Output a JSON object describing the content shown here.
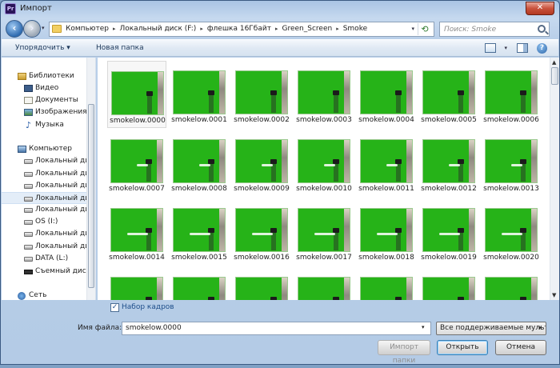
{
  "window": {
    "title": "Импорт",
    "app_icon": "Pr",
    "close": "✕"
  },
  "address": {
    "crumbs": [
      "Компьютер",
      "Локальный диск (F:)",
      "флешка 16Гбайт",
      "Green_Screen",
      "Smoke"
    ],
    "search_placeholder": "Поиск: Smoke"
  },
  "toolbar": {
    "organize_label": "Упорядочить ▾",
    "new_folder_label": "Новая папка",
    "help": "?"
  },
  "sidebar": {
    "items": [
      {
        "label": "Библиотеки",
        "icon": "library-icon"
      },
      {
        "label": "Видео",
        "icon": "video-icon"
      },
      {
        "label": "Документы",
        "icon": "documents-icon"
      },
      {
        "label": "Изображения",
        "icon": "pictures-icon"
      },
      {
        "label": "Музыка",
        "icon": "music-icon"
      },
      {
        "label": "Компьютер",
        "icon": "computer-icon"
      },
      {
        "label": "Локальный диск (C:)",
        "icon": "drive-icon"
      },
      {
        "label": "Локальный диск (D:)",
        "icon": "drive-icon"
      },
      {
        "label": "Локальный диск (E:)",
        "icon": "drive-icon"
      },
      {
        "label": "Локальный диск (F:)",
        "icon": "drive-icon"
      },
      {
        "label": "Локальный диск (G:)",
        "icon": "drive-icon"
      },
      {
        "label": "OS (I:)",
        "icon": "drive-icon"
      },
      {
        "label": "Локальный диск (J:)",
        "icon": "drive-icon"
      },
      {
        "label": "Локальный диск (K:)",
        "icon": "drive-icon"
      },
      {
        "label": "DATA (L:)",
        "icon": "drive-icon"
      },
      {
        "label": "Съемный диск (M:)",
        "icon": "removable-drive-icon"
      },
      {
        "label": "Сеть",
        "icon": "network-icon"
      }
    ]
  },
  "files": [
    "smokelow.0000",
    "smokelow.0001",
    "smokelow.0002",
    "smokelow.0003",
    "smokelow.0004",
    "smokelow.0005",
    "smokelow.0006",
    "smokelow.0007",
    "smokelow.0008",
    "smokelow.0009",
    "smokelow.0010",
    "smokelow.0011",
    "smokelow.0012",
    "smokelow.0013",
    "smokelow.0014",
    "smokelow.0015",
    "smokelow.0016",
    "smokelow.0017",
    "smokelow.0018",
    "smokelow.0019",
    "smokelow.0020"
  ],
  "bottom": {
    "sequence_label": "Набор кадров",
    "filename_label": "Имя файла:",
    "filename_value": "smokelow.0000",
    "filetype_value": "Все поддерживаемые мультимедиа",
    "import_folder_label": "Импорт папки",
    "open_label": "Открыть",
    "cancel_label": "Отмена"
  },
  "colors": {
    "green_screen": "#26b318",
    "accent": "#1f4f8a"
  }
}
